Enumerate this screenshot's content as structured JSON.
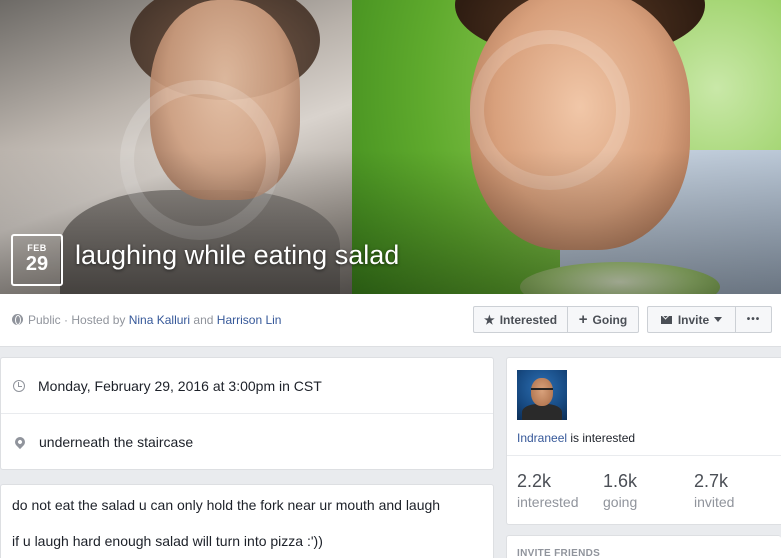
{
  "event": {
    "date_month": "FEB",
    "date_day": "29",
    "title": "laughing while eating salad"
  },
  "host_line": {
    "privacy": "Public",
    "hosted_by_prefix": " · Hosted by ",
    "host1": "Nina Kalluri",
    "conjunction": " and ",
    "host2": "Harrison Lin"
  },
  "actions": {
    "interested_label": "Interested",
    "going_label": "Going",
    "invite_label": "Invite",
    "more_label": "•••",
    "interested_icon": "star-icon",
    "going_icon": "plus-icon"
  },
  "details": {
    "datetime": "Monday, February 29, 2016 at 3:00pm in CST",
    "location": "underneath the staircase"
  },
  "description": {
    "line1": "do not eat the salad u can only hold the fork near ur mouth and laugh",
    "line2": "if u laugh hard enough salad will turn into pizza :'))"
  },
  "guests": {
    "friend_name": "Indraneel",
    "friend_status": " is interested",
    "interested_count": "2.2k",
    "interested_label": "interested",
    "going_count": "1.6k",
    "going_label": "going",
    "invited_count": "2.7k",
    "invited_label": "invited"
  },
  "invite_friends": {
    "header": "INVITE FRIENDS"
  },
  "colors": {
    "link": "#365899",
    "muted": "#90949c",
    "background": "#e9ebee"
  }
}
